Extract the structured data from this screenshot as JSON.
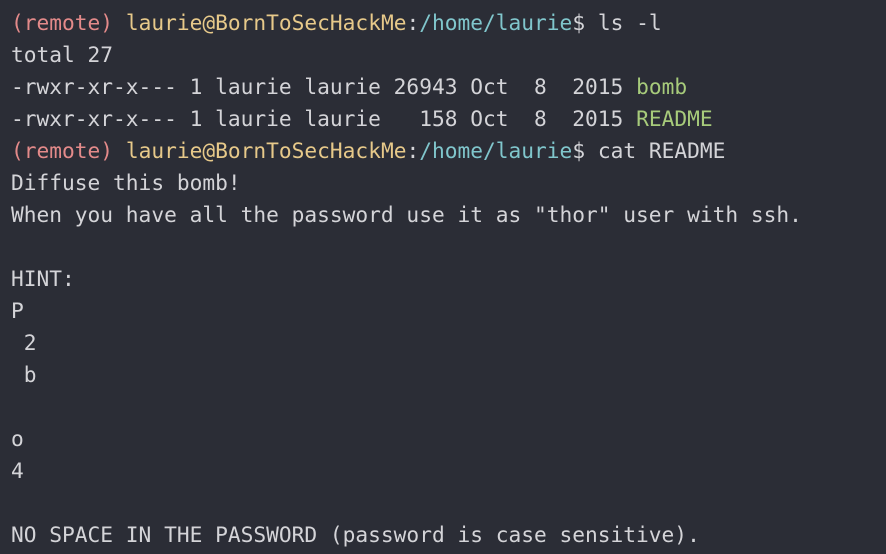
{
  "colors": {
    "background": "#2b2d36",
    "text": "#d4d4d8",
    "remote_tag": "#e38a8a",
    "user_host": "#e7c98a",
    "path": "#80c6cc",
    "executable": "#a7cb7b"
  },
  "prompt": {
    "remote_tag": "(remote)",
    "user_host": "laurie@BornToSecHackMe",
    "separator": ":",
    "path": "/home/laurie",
    "symbol": "$"
  },
  "commands": {
    "ls": "ls -l",
    "cat": "cat README"
  },
  "ls_output": {
    "total": "total 27",
    "entries": [
      {
        "meta": "-rwxr-xr-x--- 1 laurie laurie 26943 Oct  8  2015",
        "name": "bomb"
      },
      {
        "meta": "-rwxr-xr-x--- 1 laurie laurie   158 Oct  8  2015",
        "name": "README"
      }
    ]
  },
  "readme_lines": [
    "Diffuse this bomb!",
    "When you have all the password use it as \"thor\" user with ssh.",
    "",
    "HINT:",
    "P",
    " 2",
    " b",
    "",
    "o",
    "4",
    "",
    "NO SPACE IN THE PASSWORD (password is case sensitive)."
  ]
}
